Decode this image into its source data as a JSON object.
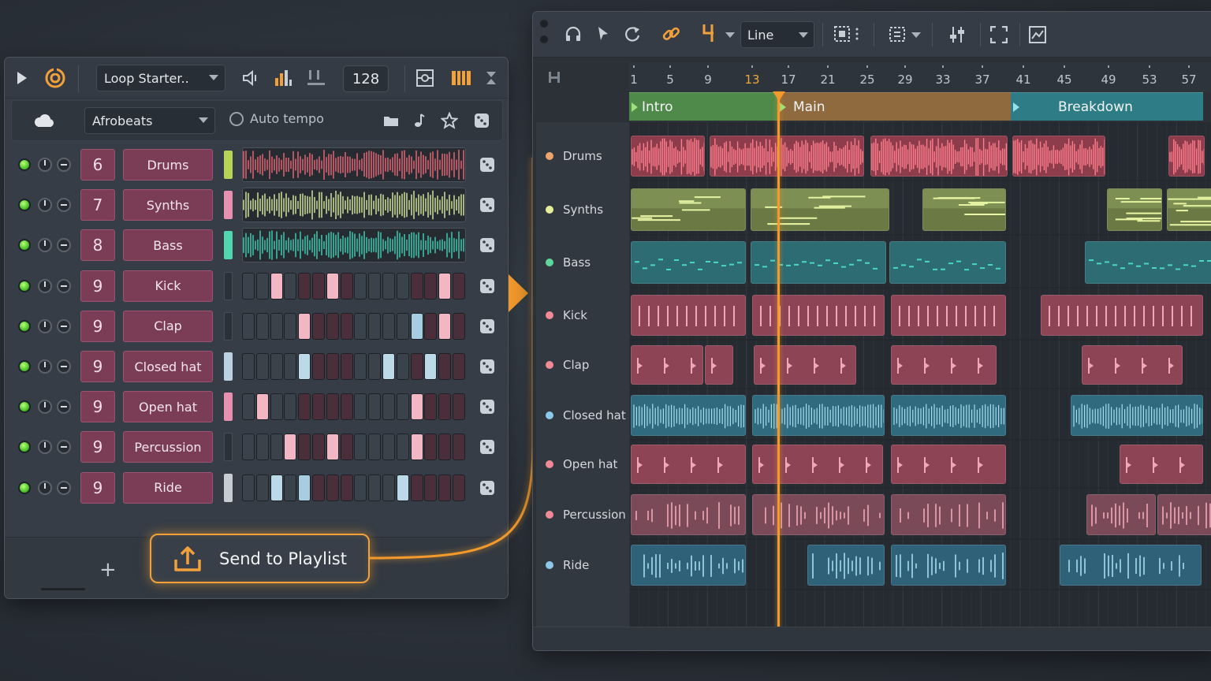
{
  "rack": {
    "pattern_name": "Loop Starter..",
    "tempo": "128",
    "genre": "Afrobeats",
    "auto_tempo_label": "Auto tempo",
    "channels": [
      {
        "num": "6",
        "name": "Drums",
        "kind": "wave",
        "color": "#f06a7a",
        "sel": "#b6d456"
      },
      {
        "num": "7",
        "name": "Synths",
        "kind": "wave",
        "color": "#d9f0a0",
        "sel": "#e890b0"
      },
      {
        "num": "8",
        "name": "Bass",
        "kind": "wave",
        "color": "#3fd6b8",
        "sel": "#52d6b0"
      },
      {
        "num": "9",
        "name": "Kick",
        "kind": "steps",
        "steps": [
          0,
          0,
          1,
          0,
          0,
          0,
          1,
          0,
          0,
          0,
          0,
          0,
          0,
          0,
          1,
          0
        ],
        "step_color": "#f2b7c2",
        "sel": ""
      },
      {
        "num": "9",
        "name": "Clap",
        "kind": "steps",
        "steps": [
          0,
          0,
          0,
          0,
          1,
          0,
          0,
          0,
          0,
          0,
          0,
          0,
          2,
          0,
          1,
          0
        ],
        "step_color": "#f2b7c2",
        "sel": ""
      },
      {
        "num": "9",
        "name": "Closed hat",
        "kind": "steps",
        "steps": [
          0,
          0,
          0,
          0,
          1,
          0,
          0,
          0,
          0,
          0,
          1,
          0,
          0,
          1,
          0,
          0
        ],
        "step_color": "#bcd9e8",
        "sel": "#bcd2e2"
      },
      {
        "num": "9",
        "name": "Open hat",
        "kind": "steps",
        "steps": [
          0,
          1,
          0,
          0,
          0,
          0,
          0,
          0,
          0,
          0,
          0,
          0,
          1,
          0,
          0,
          0
        ],
        "step_color": "#f2b7c2",
        "sel": "#e890b0"
      },
      {
        "num": "9",
        "name": "Percussion",
        "kind": "steps",
        "steps": [
          0,
          0,
          0,
          1,
          0,
          0,
          1,
          0,
          0,
          0,
          0,
          0,
          1,
          0,
          0,
          0
        ],
        "step_color": "#f2b7c2",
        "sel": ""
      },
      {
        "num": "9",
        "name": "Ride",
        "kind": "steps",
        "steps": [
          0,
          0,
          1,
          0,
          2,
          0,
          0,
          0,
          0,
          0,
          0,
          1,
          0,
          0,
          0,
          0
        ],
        "step_color": "#bcd9e8",
        "sel": "#c7ccd2"
      }
    ],
    "add_label": "+",
    "send_label": "Send to Playlist"
  },
  "playlist": {
    "snap_mode": "Line",
    "ruler": [
      "1",
      "5",
      "9",
      "13",
      "17",
      "21",
      "25",
      "29",
      "33",
      "37",
      "41",
      "45",
      "49",
      "53",
      "57"
    ],
    "ruler_highlight": "13",
    "markers": [
      {
        "label": "Intro",
        "color": "#4f8a4a"
      },
      {
        "label": "Main",
        "color": "#8f6a3e"
      },
      {
        "label": "Breakdown",
        "color": "#2e7d86"
      }
    ],
    "tracks": [
      {
        "name": "Drums",
        "color": "#f0a36a"
      },
      {
        "name": "Synths",
        "color": "#e5ef9a"
      },
      {
        "name": "Bass",
        "color": "#5fd69a"
      },
      {
        "name": "Kick",
        "color": "#f08a96"
      },
      {
        "name": "Clap",
        "color": "#f08a96"
      },
      {
        "name": "Closed hat",
        "color": "#8ec8e8"
      },
      {
        "name": "Open hat",
        "color": "#f08a96"
      },
      {
        "name": "Percussion",
        "color": "#f08a96"
      },
      {
        "name": "Ride",
        "color": "#8ec8e8"
      }
    ]
  },
  "colors": {
    "accent": "#f29a2c",
    "channel_button": "#7b3d55",
    "led_on": "#4fc52a"
  }
}
